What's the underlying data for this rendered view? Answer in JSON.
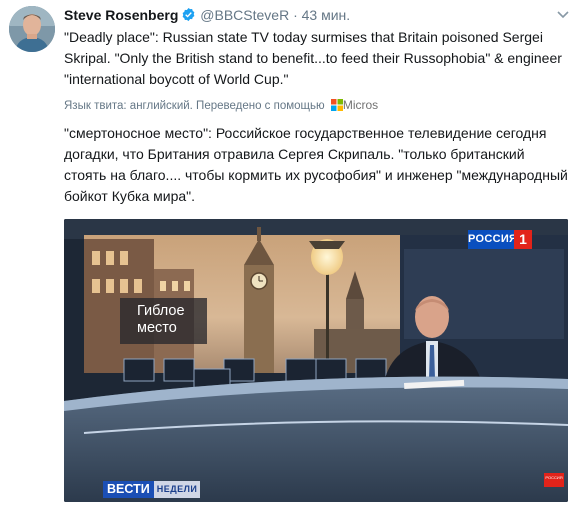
{
  "tweet": {
    "author_name": "Steve Rosenberg",
    "handle": "@BBCSteveR",
    "separator": "·",
    "time": "43 мин.",
    "text": "\"Deadly place\": Russian state TV today surmises that Britain poisoned Sergei Skripal. \"Only the British stand to benefit...to feed their Russophobia\" & engineer \"international boycott of World Cup.\"",
    "translate_label": "Язык твита: английский. Переведено с помощью",
    "translate_provider": "Micros",
    "translated_text": "\"смертоносное место\": Российское государственное телевидение сегодня догадки, что Британия отравила Сергея Скрипаль. \"только британский стоять на благо.... чтобы кормить их русофобия\" и инженер \"международный бойкот Кубка мира\"."
  },
  "media": {
    "caption": "Гиблое место",
    "caption_line1": "Гиблое",
    "caption_line2": "место",
    "channel_logo": "РОССИЯ",
    "channel_number": "1",
    "show_title_a": "ВЕСТИ",
    "show_title_b": "НЕДЕЛИ",
    "corner_logo": "РОССИЯ"
  },
  "icons": {
    "verified": "verified-badge-icon",
    "caret": "chevron-down-icon",
    "microsoft": "microsoft-logo-icon"
  },
  "colors": {
    "verified_blue": "#1da1f2",
    "secondary_text": "#657786",
    "primary_text": "#14171a"
  }
}
